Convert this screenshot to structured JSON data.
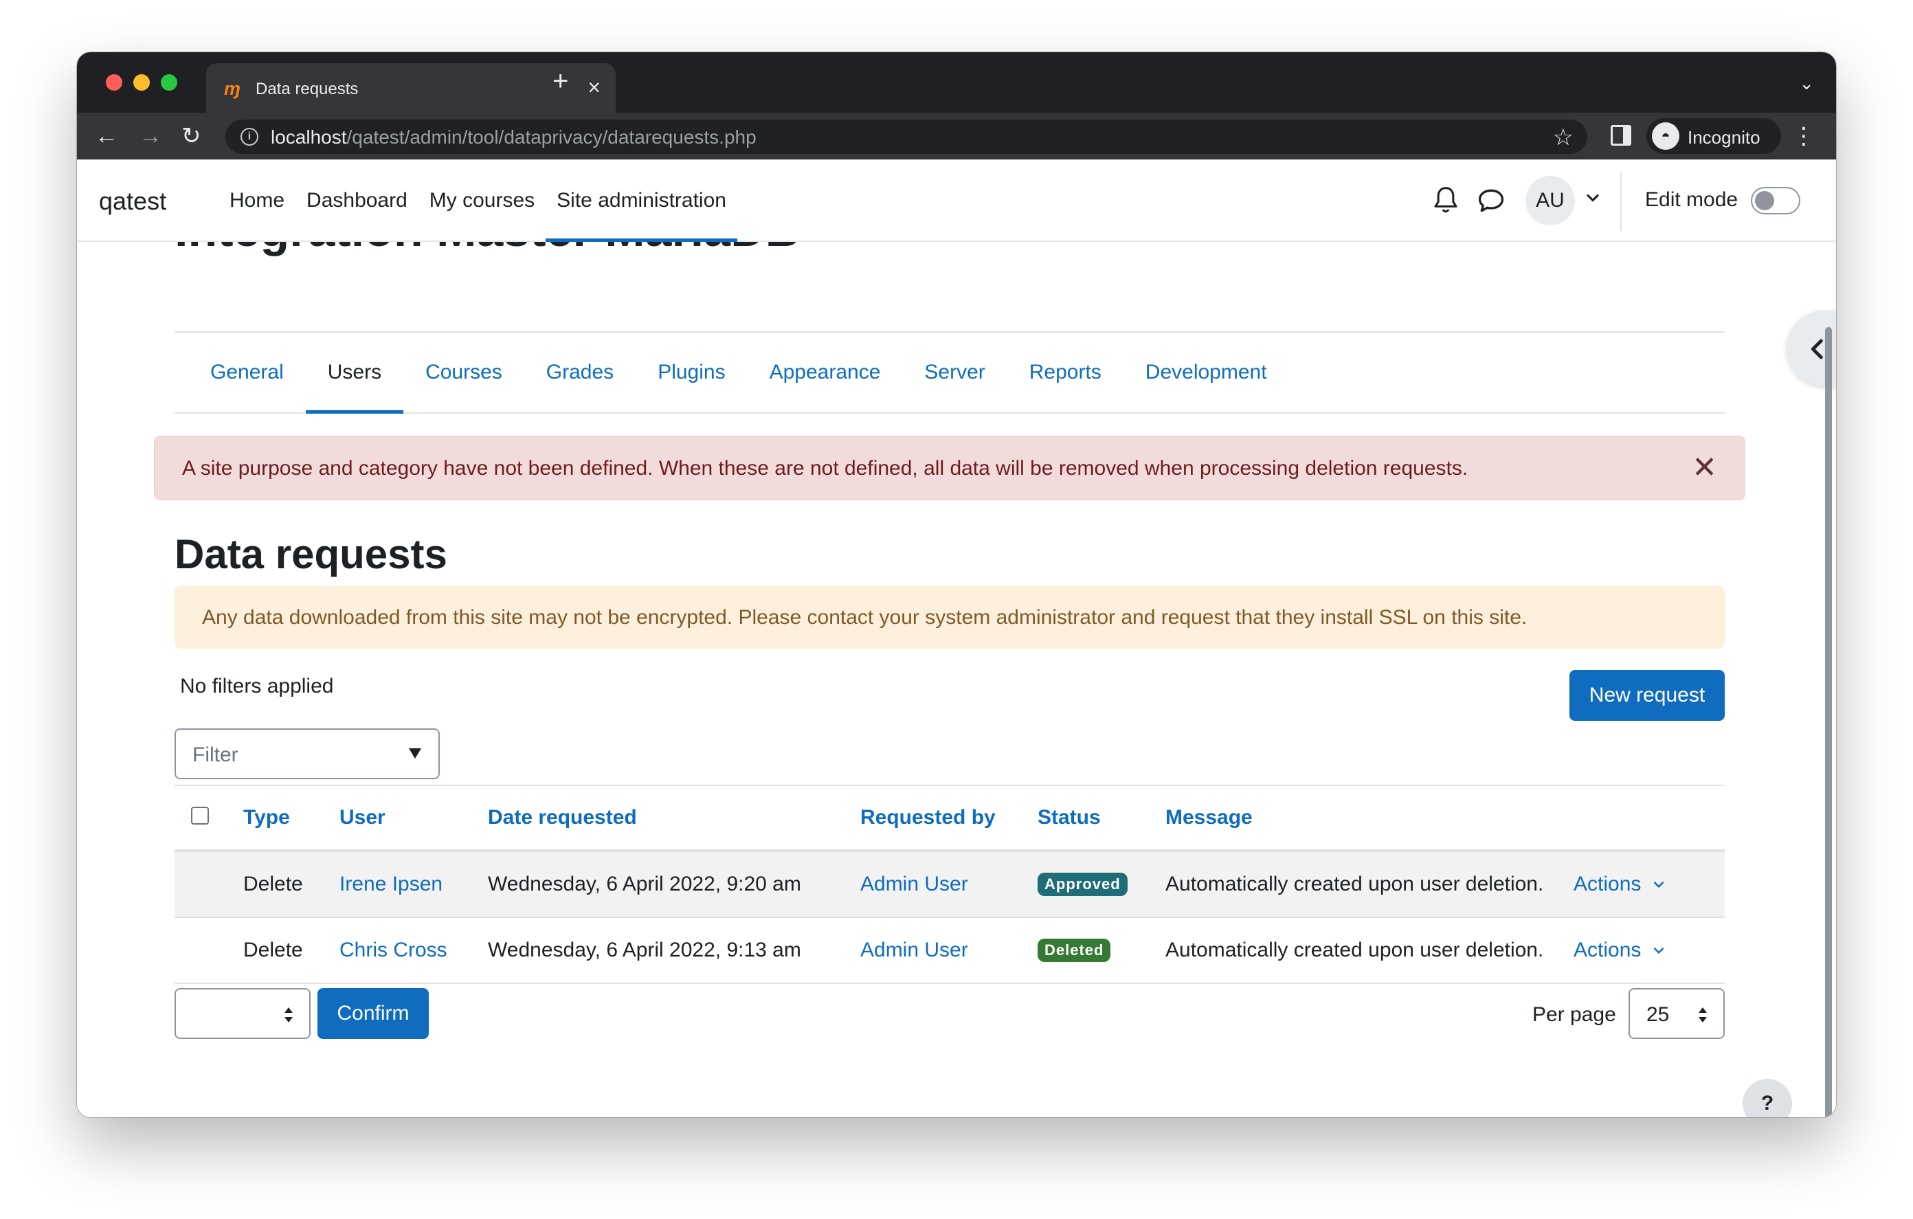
{
  "browser": {
    "tab_title": "Data requests",
    "tab_favicon": "ɱ",
    "url_host": "localhost",
    "url_path": "/qatest/admin/tool/dataprivacy/datarequests.php",
    "incognito_label": "Incognito",
    "icons": [
      "back-icon",
      "forward-icon",
      "reload-icon",
      "info-icon",
      "star-icon",
      "side-panel-icon",
      "incognito-icon",
      "kebab-menu-icon",
      "close-icon",
      "new-tab-icon",
      "tab-search-icon"
    ]
  },
  "navbar": {
    "brand": "qatest",
    "items": [
      {
        "label": "Home"
      },
      {
        "label": "Dashboard"
      },
      {
        "label": "My courses"
      },
      {
        "label": "Site administration"
      }
    ],
    "avatar_initials": "AU",
    "edit_mode_label": "Edit mode",
    "edit_mode_on": false
  },
  "hidden_heading": "Integration Master MariaDB",
  "secondary_nav": {
    "tabs": [
      {
        "label": "General"
      },
      {
        "label": "Users"
      },
      {
        "label": "Courses"
      },
      {
        "label": "Grades"
      },
      {
        "label": "Plugins"
      },
      {
        "label": "Appearance"
      },
      {
        "label": "Server"
      },
      {
        "label": "Reports"
      },
      {
        "label": "Development"
      }
    ],
    "active_index": 1
  },
  "alerts": {
    "danger": "A site purpose and category have not been defined. When these are not defined, all data will be removed when processing deletion requests.",
    "close_glyph": "✕",
    "warning": "Any data downloaded from this site may not be encrypted. Please contact your system administrator and request that they install SSL on this site."
  },
  "page": {
    "title": "Data requests",
    "filters_label": "No filters applied",
    "new_request_label": "New request",
    "filter_placeholder": "Filter"
  },
  "table": {
    "headers": {
      "type": "Type",
      "user": "User",
      "date": "Date requested",
      "requested_by": "Requested by",
      "status": "Status",
      "message": "Message"
    },
    "rows": [
      {
        "type": "Delete",
        "user": "Irene Ipsen",
        "date": "Wednesday, 6 April 2022, 9:20 am",
        "requested_by": "Admin User",
        "status": "Approved",
        "message": "Automatically created upon user deletion.",
        "actions": "Actions"
      },
      {
        "type": "Delete",
        "user": "Chris Cross",
        "date": "Wednesday, 6 April 2022, 9:13 am",
        "requested_by": "Admin User",
        "status": "Deleted",
        "message": "Automatically created upon user deletion.",
        "actions": "Actions"
      }
    ]
  },
  "footer": {
    "confirm_label": "Confirm",
    "per_page_label": "Per page",
    "per_page_value": "25",
    "help_label": "?"
  },
  "colors": {
    "primary": "#0f6cbf",
    "approved_badge": "#1f6e77",
    "deleted_badge": "#357a32",
    "danger_bg": "#f2dbdb",
    "warning_bg": "#fcefdc"
  }
}
